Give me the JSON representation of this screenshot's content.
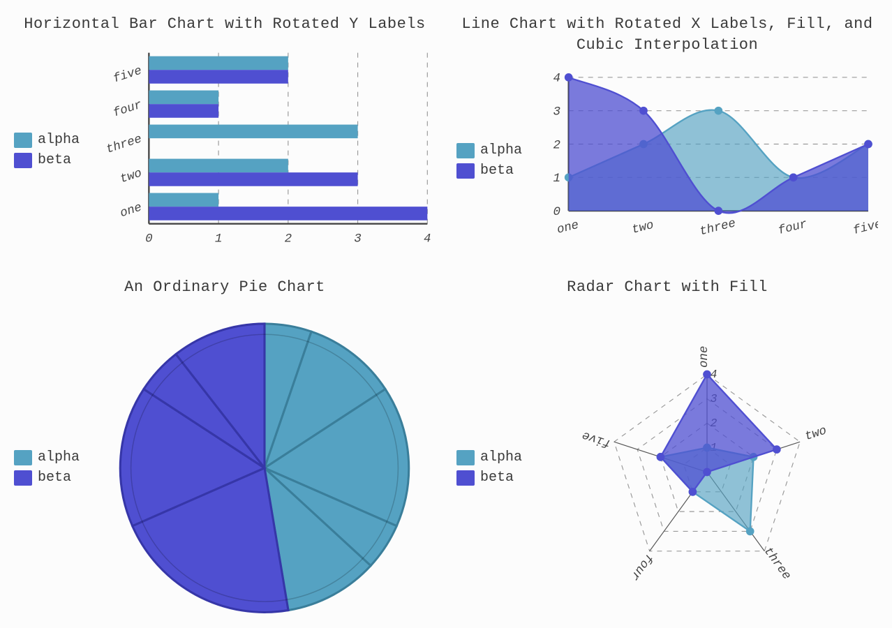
{
  "colors": {
    "alpha": "#55a2c2",
    "beta": "#4f4fd1",
    "alphaFill": "rgba(85,162,194,0.65)",
    "betaFill": "rgba(79,79,209,0.75)"
  },
  "legend": {
    "alpha": "alpha",
    "beta": "beta"
  },
  "chart_data": [
    {
      "id": "hbar",
      "type": "bar",
      "orientation": "horizontal",
      "title": "Horizontal Bar Chart with Rotated Y Labels",
      "categories": [
        "one",
        "two",
        "three",
        "four",
        "five"
      ],
      "series": [
        {
          "name": "alpha",
          "values": [
            1,
            2,
            3,
            1,
            2
          ]
        },
        {
          "name": "beta",
          "values": [
            4,
            3,
            0,
            1,
            2
          ]
        }
      ],
      "xlim": [
        0,
        4
      ],
      "xticks": [
        0,
        1,
        2,
        3,
        4
      ]
    },
    {
      "id": "line",
      "type": "area",
      "title": "Line Chart with Rotated X Labels, Fill, and Cubic Interpolation",
      "categories": [
        "one",
        "two",
        "three",
        "four",
        "five"
      ],
      "series": [
        {
          "name": "alpha",
          "values": [
            1,
            2,
            3,
            1,
            2
          ]
        },
        {
          "name": "beta",
          "values": [
            4,
            3,
            0,
            1,
            2
          ]
        }
      ],
      "ylim": [
        0,
        4
      ],
      "yticks": [
        0,
        1,
        2,
        3,
        4
      ]
    },
    {
      "id": "pie",
      "type": "pie",
      "title": "An Ordinary Pie Chart",
      "series": [
        {
          "name": "alpha",
          "values": [
            1,
            2,
            3,
            1,
            2
          ]
        },
        {
          "name": "beta",
          "values": [
            4,
            3,
            0,
            1,
            2
          ]
        }
      ]
    },
    {
      "id": "radar",
      "type": "radar",
      "title": "Radar Chart with Fill",
      "categories": [
        "one",
        "two",
        "three",
        "four",
        "five"
      ],
      "series": [
        {
          "name": "alpha",
          "values": [
            1,
            2,
            3,
            1,
            2
          ]
        },
        {
          "name": "beta",
          "values": [
            4,
            3,
            0,
            1,
            2
          ]
        }
      ],
      "rticks": [
        1,
        2,
        3,
        4
      ],
      "rmax": 4
    }
  ]
}
